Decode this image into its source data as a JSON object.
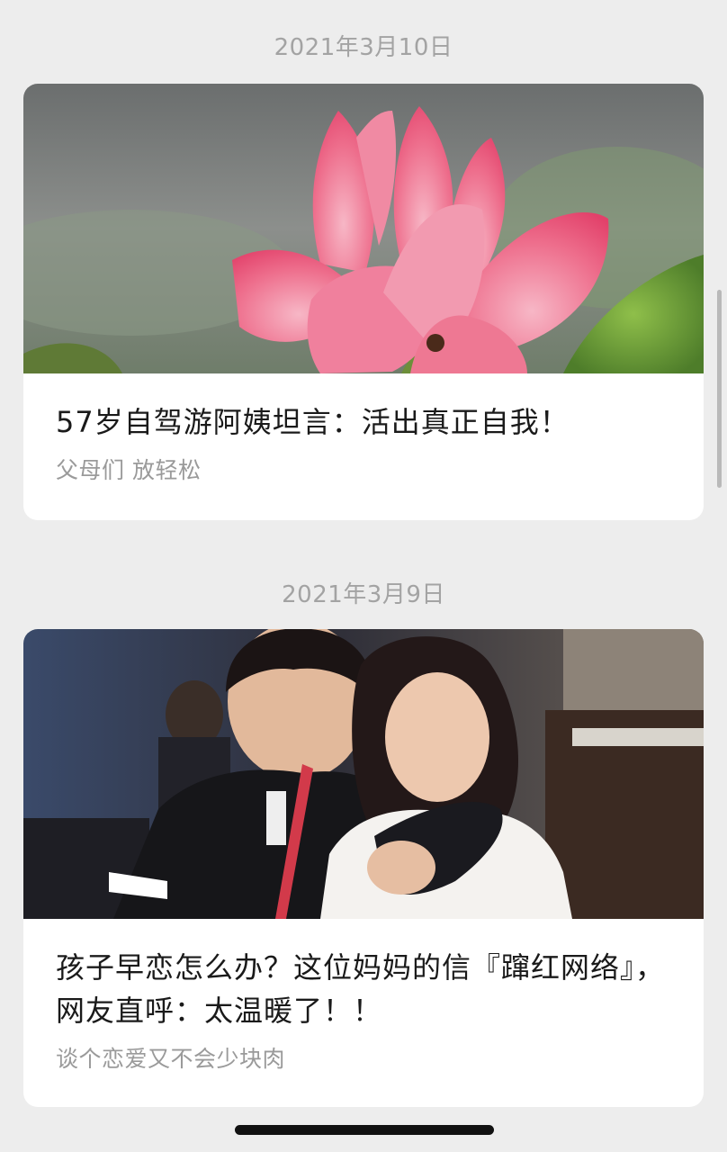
{
  "feed": {
    "articles": [
      {
        "date": "2021年3月10日",
        "image": "pink-lotus-flower-photo",
        "title": "57岁自驾游阿姨坦言：活出真正自我！",
        "source": "父母们 放轻松"
      },
      {
        "date": "2021年3月9日",
        "image": "young-couple-photo",
        "title": "孩子早恋怎么办？这位妈妈的信『蹿红网络』，网友直呼：太温暖了！！",
        "source": "谈个恋爱又不会少块肉"
      }
    ]
  },
  "colors": {
    "background": "#ededed",
    "card": "#ffffff",
    "date_text": "#a3a3a3",
    "title_text": "#1a1a1a",
    "source_text": "#9a9a9a"
  }
}
